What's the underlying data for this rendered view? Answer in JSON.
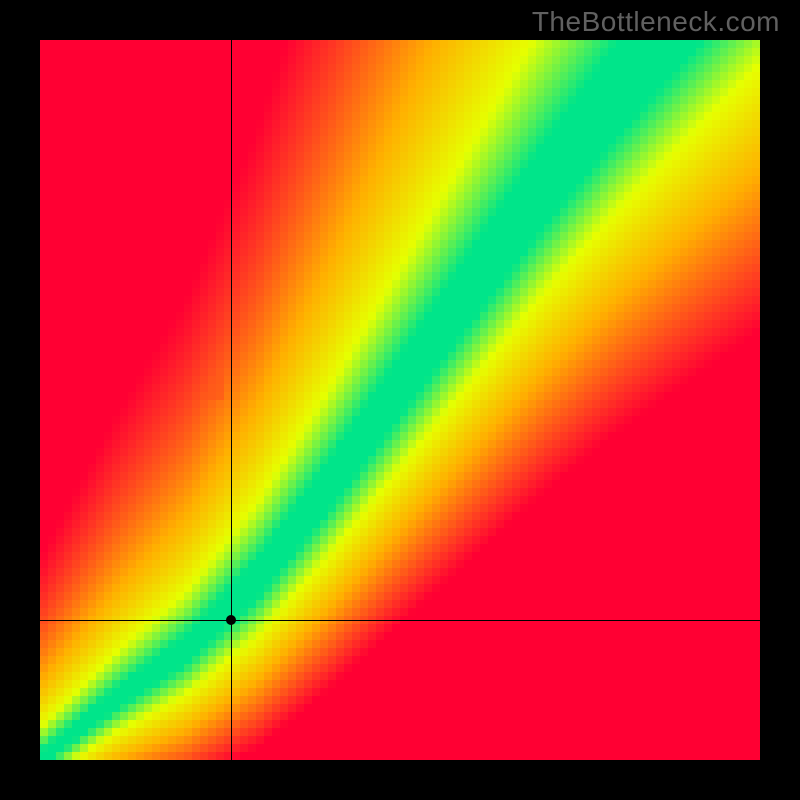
{
  "watermark": "TheBottleneck.com",
  "canvas_size": 720,
  "grid_resolution": 90,
  "crosshair": {
    "x_frac": 0.265,
    "y_frac": 0.805
  },
  "chart_data": {
    "type": "heatmap",
    "title": "",
    "xlabel": "",
    "ylabel": "",
    "xlim": [
      0,
      1
    ],
    "ylim": [
      0,
      1
    ],
    "description": "Bottleneck heatmap. X axis = normalized CPU score, Y axis = normalized GPU score. Color encodes bottleneck severity: green = balanced (ratio ~ ideal), yellow = mild, red = severe. A green optimal band runs diagonally from lower-left to upper-right with slope > 1; band widens at higher scores. Crosshair marks the user's current hardware position.",
    "crosshair_point": {
      "x": 0.265,
      "y": 0.195
    },
    "optimal_band": {
      "note": "Green band center defined by y ≈ f(x); width grows with x.",
      "samples": [
        {
          "x": 0.0,
          "y_center": 0.0,
          "half_width": 0.01
        },
        {
          "x": 0.1,
          "y_center": 0.08,
          "half_width": 0.015
        },
        {
          "x": 0.2,
          "y_center": 0.15,
          "half_width": 0.02
        },
        {
          "x": 0.3,
          "y_center": 0.25,
          "half_width": 0.028
        },
        {
          "x": 0.4,
          "y_center": 0.38,
          "half_width": 0.035
        },
        {
          "x": 0.5,
          "y_center": 0.52,
          "half_width": 0.042
        },
        {
          "x": 0.6,
          "y_center": 0.66,
          "half_width": 0.05
        },
        {
          "x": 0.7,
          "y_center": 0.8,
          "half_width": 0.058
        },
        {
          "x": 0.8,
          "y_center": 0.93,
          "half_width": 0.065
        },
        {
          "x": 0.9,
          "y_center": 1.05,
          "half_width": 0.072
        },
        {
          "x": 1.0,
          "y_center": 1.17,
          "half_width": 0.08
        }
      ]
    },
    "color_scale": [
      {
        "stop": 0.0,
        "color": "#00e58a",
        "meaning": "balanced"
      },
      {
        "stop": 0.25,
        "color": "#e6ff00",
        "meaning": "slight"
      },
      {
        "stop": 0.55,
        "color": "#ffb000",
        "meaning": "moderate"
      },
      {
        "stop": 1.0,
        "color": "#ff0033",
        "meaning": "severe"
      }
    ]
  }
}
